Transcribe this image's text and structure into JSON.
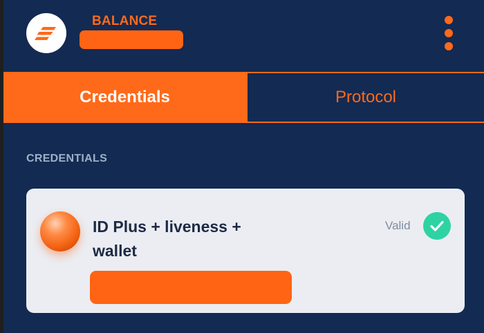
{
  "header": {
    "balance_label": "BALANCE",
    "balance_value": ""
  },
  "tabs": [
    {
      "label": "Credentials",
      "active": true
    },
    {
      "label": "Protocol",
      "active": false
    }
  ],
  "section": {
    "title": "CREDENTIALS"
  },
  "credential": {
    "name": "ID Plus + liveness + wallet",
    "status": "Valid",
    "id_value": ""
  },
  "icons": {
    "logo": "brand-logo-icon",
    "menu": "more-vertical-icon",
    "credential": "credential-orb-icon",
    "status": "check-circle-icon"
  },
  "colors": {
    "background": "#132a52",
    "accent": "#ff6a1a",
    "valid": "#2ed3a3",
    "card": "#ebedf2"
  }
}
